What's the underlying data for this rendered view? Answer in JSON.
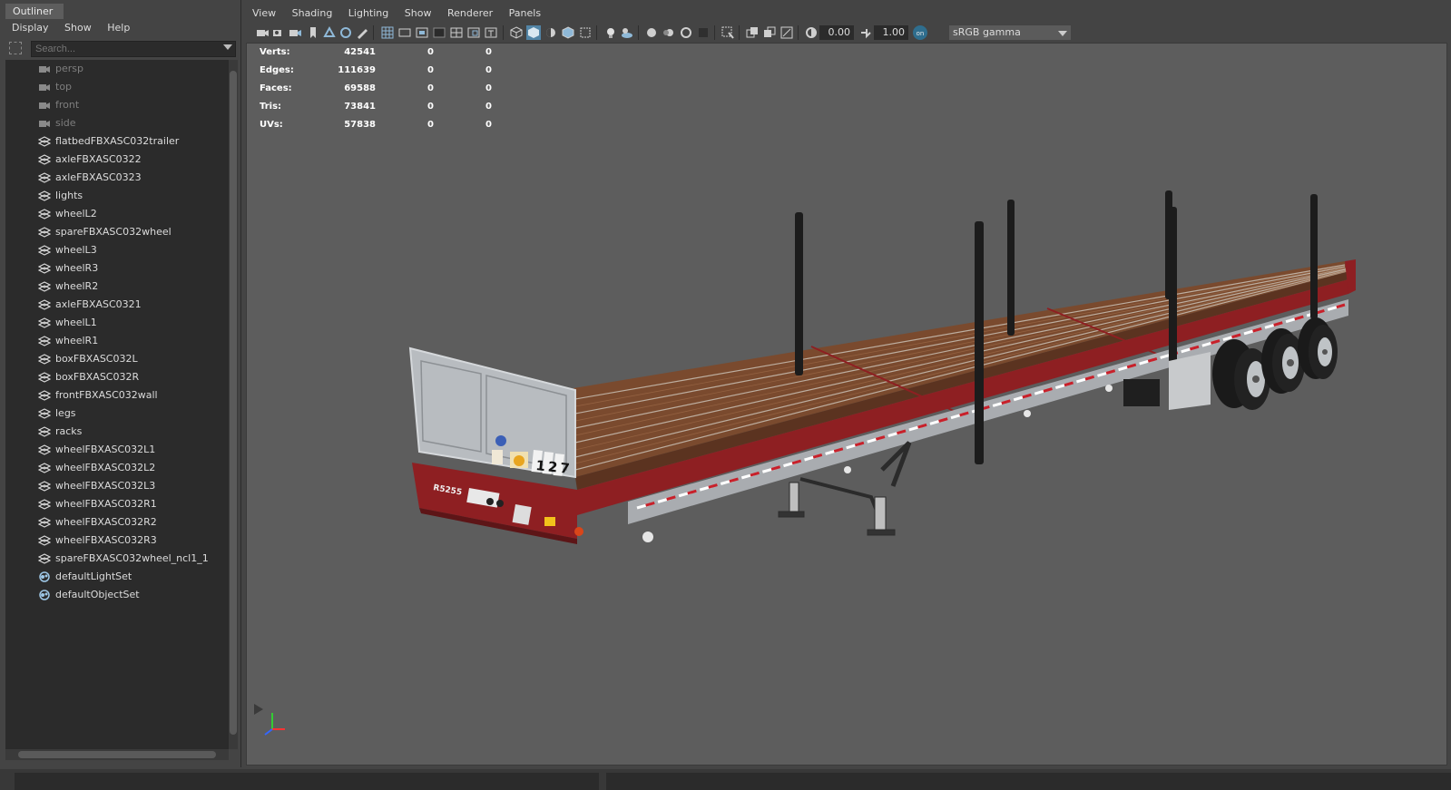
{
  "outliner": {
    "tab_label": "Outliner",
    "menus": [
      "Display",
      "Show",
      "Help"
    ],
    "search_placeholder": "Search...",
    "items": [
      {
        "label": "persp",
        "icon": "camera-icon",
        "dim": true
      },
      {
        "label": "top",
        "icon": "camera-icon",
        "dim": true
      },
      {
        "label": "front",
        "icon": "camera-icon",
        "dim": true
      },
      {
        "label": "side",
        "icon": "camera-icon",
        "dim": true
      },
      {
        "label": "flatbedFBXASC032trailer",
        "icon": "transform-icon",
        "dim": false
      },
      {
        "label": "axleFBXASC0322",
        "icon": "transform-icon",
        "dim": false
      },
      {
        "label": "axleFBXASC0323",
        "icon": "transform-icon",
        "dim": false
      },
      {
        "label": "lights",
        "icon": "transform-icon",
        "dim": false
      },
      {
        "label": "wheelL2",
        "icon": "transform-icon",
        "dim": false
      },
      {
        "label": "spareFBXASC032wheel",
        "icon": "transform-icon",
        "dim": false
      },
      {
        "label": "wheelL3",
        "icon": "transform-icon",
        "dim": false
      },
      {
        "label": "wheelR3",
        "icon": "transform-icon",
        "dim": false
      },
      {
        "label": "wheelR2",
        "icon": "transform-icon",
        "dim": false
      },
      {
        "label": "axleFBXASC0321",
        "icon": "transform-icon",
        "dim": false
      },
      {
        "label": "wheelL1",
        "icon": "transform-icon",
        "dim": false
      },
      {
        "label": "wheelR1",
        "icon": "transform-icon",
        "dim": false
      },
      {
        "label": "boxFBXASC032L",
        "icon": "transform-icon",
        "dim": false
      },
      {
        "label": "boxFBXASC032R",
        "icon": "transform-icon",
        "dim": false
      },
      {
        "label": "frontFBXASC032wall",
        "icon": "transform-icon",
        "dim": false
      },
      {
        "label": "legs",
        "icon": "transform-icon",
        "dim": false
      },
      {
        "label": "racks",
        "icon": "transform-icon",
        "dim": false
      },
      {
        "label": "wheelFBXASC032L1",
        "icon": "transform-icon",
        "dim": false
      },
      {
        "label": "wheelFBXASC032L2",
        "icon": "transform-icon",
        "dim": false
      },
      {
        "label": "wheelFBXASC032L3",
        "icon": "transform-icon",
        "dim": false
      },
      {
        "label": "wheelFBXASC032R1",
        "icon": "transform-icon",
        "dim": false
      },
      {
        "label": "wheelFBXASC032R2",
        "icon": "transform-icon",
        "dim": false
      },
      {
        "label": "wheelFBXASC032R3",
        "icon": "transform-icon",
        "dim": false
      },
      {
        "label": "spareFBXASC032wheel_ncl1_1",
        "icon": "transform-icon",
        "dim": false
      },
      {
        "label": "defaultLightSet",
        "icon": "set-icon",
        "dim": false
      },
      {
        "label": "defaultObjectSet",
        "icon": "set-icon",
        "dim": false
      }
    ]
  },
  "panel": {
    "menus": [
      "View",
      "Shading",
      "Lighting",
      "Show",
      "Renderer",
      "Panels"
    ],
    "toolbar": {
      "exposure_value": "0.00",
      "gamma_value": "1.00",
      "color_space": "sRGB gamma"
    }
  },
  "hud": {
    "rows": [
      {
        "label": "Verts:",
        "v1": "42541",
        "v2": "0",
        "v3": "0"
      },
      {
        "label": "Edges:",
        "v1": "111639",
        "v2": "0",
        "v3": "0"
      },
      {
        "label": "Faces:",
        "v1": "69588",
        "v2": "0",
        "v3": "0"
      },
      {
        "label": "Tris:",
        "v1": "73841",
        "v2": "0",
        "v3": "0"
      },
      {
        "label": "UVs:",
        "v1": "57838",
        "v2": "0",
        "v3": "0"
      }
    ]
  },
  "model": {
    "plate_text": "R5255",
    "trailer_number": "127",
    "deck_color": "#7a4a2e",
    "frame_color": "#8e1f22",
    "stake_color": "#1c1c1c",
    "headboard_color": "#b8bcc0"
  }
}
